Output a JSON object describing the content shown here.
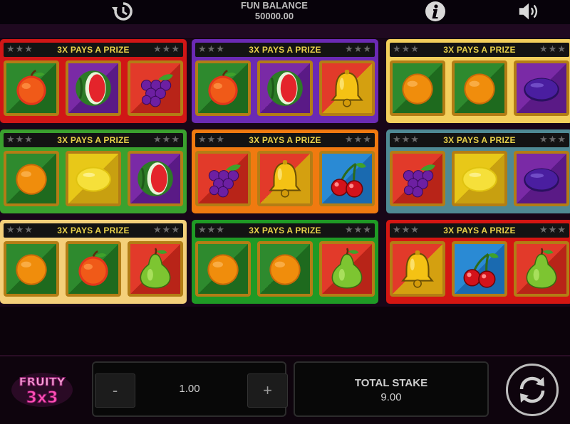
{
  "header": {
    "balance_label": "FUN BALANCE",
    "balance_value": "50000.00",
    "icons": [
      "history-icon",
      "info-icon",
      "sound-icon"
    ]
  },
  "cards": [
    {
      "banner": "3X PAYS A PRIZE",
      "frame": "#d11616",
      "cells": [
        "orange-apple",
        "watermelon",
        "grapes"
      ]
    },
    {
      "banner": "3X PAYS A PRIZE",
      "frame": "#6b2ab4",
      "cells": [
        "orange-apple",
        "watermelon",
        "bell"
      ]
    },
    {
      "banner": "3X PAYS A PRIZE",
      "frame": "#f3cf5c",
      "cells": [
        "orange",
        "orange",
        "plum"
      ]
    },
    {
      "banner": "3X PAYS A PRIZE",
      "frame": "#3aa12e",
      "cells": [
        "orange",
        "lemon",
        "watermelon"
      ]
    },
    {
      "banner": "3X PAYS A PRIZE",
      "frame": "#f07a10",
      "cells": [
        "grapes",
        "bell",
        "cherries"
      ]
    },
    {
      "banner": "3X PAYS A PRIZE",
      "frame": "#4f8a94",
      "cells": [
        "grapes",
        "lemon",
        "plum"
      ]
    },
    {
      "banner": "3X PAYS A PRIZE",
      "frame": "#f4d07a",
      "cells": [
        "orange",
        "orange-apple",
        "pear"
      ]
    },
    {
      "banner": "3X PAYS A PRIZE",
      "frame": "#1f9a25",
      "cells": [
        "orange",
        "orange",
        "pear"
      ]
    },
    {
      "banner": "3X PAYS A PRIZE",
      "frame": "#d41612",
      "cells": [
        "bell",
        "cherries",
        "pear"
      ]
    }
  ],
  "controls": {
    "logo_top": "FRUITY",
    "logo_bottom": "3x3",
    "minus_label": "-",
    "plus_label": "+",
    "bet_value": "1.00",
    "total_stake_label": "TOTAL STAKE",
    "total_stake_value": "9.00",
    "spin_icon": "refresh-icon"
  },
  "colors": {
    "banner_text": "#e8d14a",
    "background": "#0c030b"
  }
}
